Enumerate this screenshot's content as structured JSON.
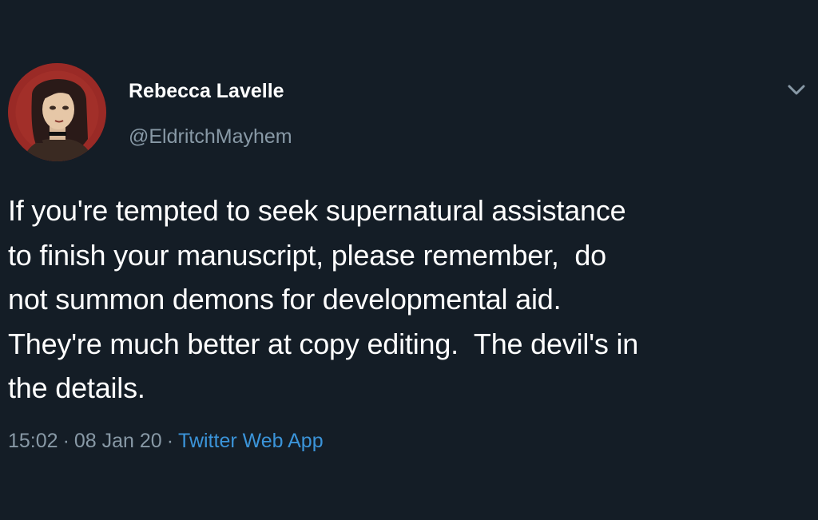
{
  "tweet": {
    "author": {
      "name": "Rebecca Lavelle",
      "handle": "@EldritchMayhem"
    },
    "text": "If you're tempted to seek supernatural assistance\nto finish your manuscript, please remember,  do\nnot summon demons for developmental aid.\nThey're much better at copy editing.  The devil's in\nthe details.",
    "time": "15:02",
    "date": "08 Jan 20",
    "separator": "·",
    "source": "Twitter Web App"
  },
  "colors": {
    "background": "#141d26",
    "text": "#ffffff",
    "secondary": "#8899a6",
    "link": "#3b94d9",
    "avatar_bg": "#8b2424"
  },
  "icons": {
    "menu": "chevron-down-icon",
    "avatar": "avatar-illustration"
  }
}
